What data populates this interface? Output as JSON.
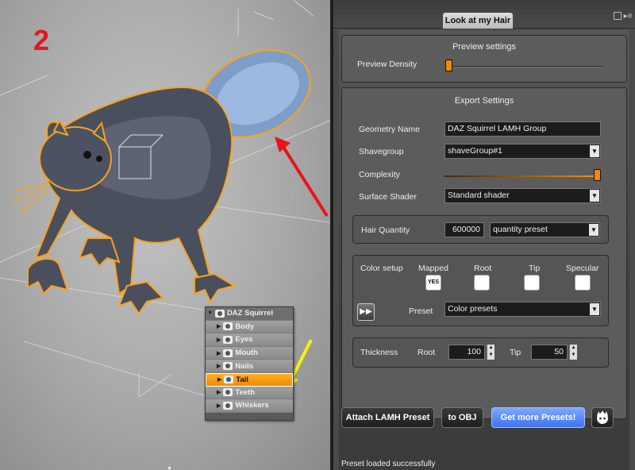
{
  "viewport": {
    "step_number": "2",
    "scene_tree": {
      "root": "DAZ Squirrel",
      "children": [
        "Body",
        "Eyes",
        "Mouth",
        "Nails",
        "Tail",
        "Teeth",
        "Whiskers"
      ],
      "selected": "Tail"
    }
  },
  "panel": {
    "tab_label": "Look at my Hair",
    "preview": {
      "title": "Preview settings",
      "density_label": "Preview Density",
      "density_level": 0.0
    },
    "export": {
      "title": "Export Settings",
      "geometry_name_label": "Geometry Name",
      "geometry_name_value": "DAZ Squirrel LAMH Group",
      "shavegroup_label": "Shavegroup",
      "shavegroup_value": "shaveGroup#1",
      "complexity_label": "Complexity",
      "complexity_level": 1.0,
      "surface_shader_label": "Surface Shader",
      "surface_shader_value": "Standard shader",
      "hair_quantity_label": "Hair Quantity",
      "hair_quantity_value": "600000",
      "quantity_preset_value": "quantity preset",
      "color_setup_label": "Color setup",
      "mapped_label": "Mapped",
      "mapped_checkbox": "YES",
      "root_label": "Root",
      "tip_label": "Tip",
      "specular_label": "Specular",
      "preset_label": "Preset",
      "preset_value": "Color presets",
      "thickness_label": "Thickness",
      "thickness_root_label": "Root",
      "thickness_root_value": "100",
      "thickness_tip_label": "Tip",
      "thickness_tip_value": "50"
    },
    "buttons": {
      "attach": "Attach LAMH Preset",
      "to_obj": "to OBJ",
      "more_presets": "Get more Presets!"
    },
    "status": "Preset loaded successfully"
  },
  "colors": {
    "accent_orange": "#f5880b",
    "blue_button": "#4f7ff2",
    "step_red": "#e0191b",
    "arrow_red": "#e8141a",
    "arrow_yellow": "#f7f20a"
  }
}
